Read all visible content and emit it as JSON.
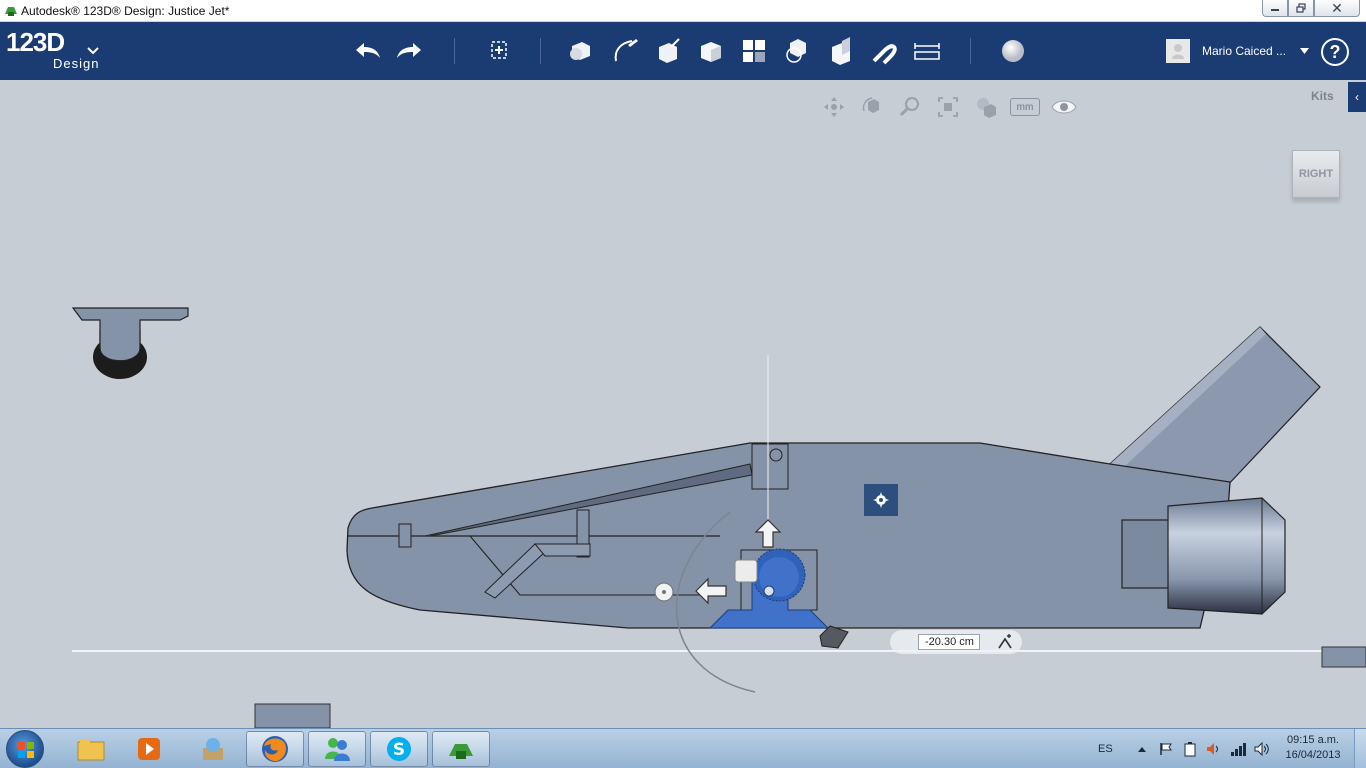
{
  "window": {
    "title": "Autodesk® 123D® Design: Justice Jet*",
    "minimize_icon": "minimize-icon",
    "maximize_icon": "restore-icon",
    "close_label": "✕"
  },
  "logo": {
    "text": "123D",
    "sub": "Design",
    "menu_icon": "chevron-down-icon"
  },
  "toolbar": {
    "undo_icon": "undo-icon",
    "redo_icon": "redo-icon",
    "tools": [
      "transform-icon",
      "primitives-icon",
      "sketch-icon",
      "construct-icon",
      "modify-icon",
      "pattern-icon",
      "grouping-icon",
      "combine-icon",
      "snap-icon",
      "measure-icon",
      "material-icon"
    ],
    "user_name": "Mario Caiced ...",
    "help_label": "?"
  },
  "view_controls": {
    "units": "mm",
    "kits_label": "Kits",
    "kits_toggle": "‹",
    "viewcube_face": "RIGHT"
  },
  "manipulator": {
    "dimension_value": "-20.30 cm"
  },
  "taskbar": {
    "language": "ES",
    "time": "09:15 a.m.",
    "date": "16/04/2013",
    "apps": [
      "explorer-icon",
      "media-player-icon",
      "app-icon",
      "firefox-icon",
      "messenger-icon",
      "skype-icon",
      "123d-design-icon"
    ]
  },
  "colors": {
    "toolbar_bg": "#1b3b73",
    "viewport_bg": "#c7cdd5",
    "model_body": "#8593a8",
    "selection": "#3f72c8"
  }
}
